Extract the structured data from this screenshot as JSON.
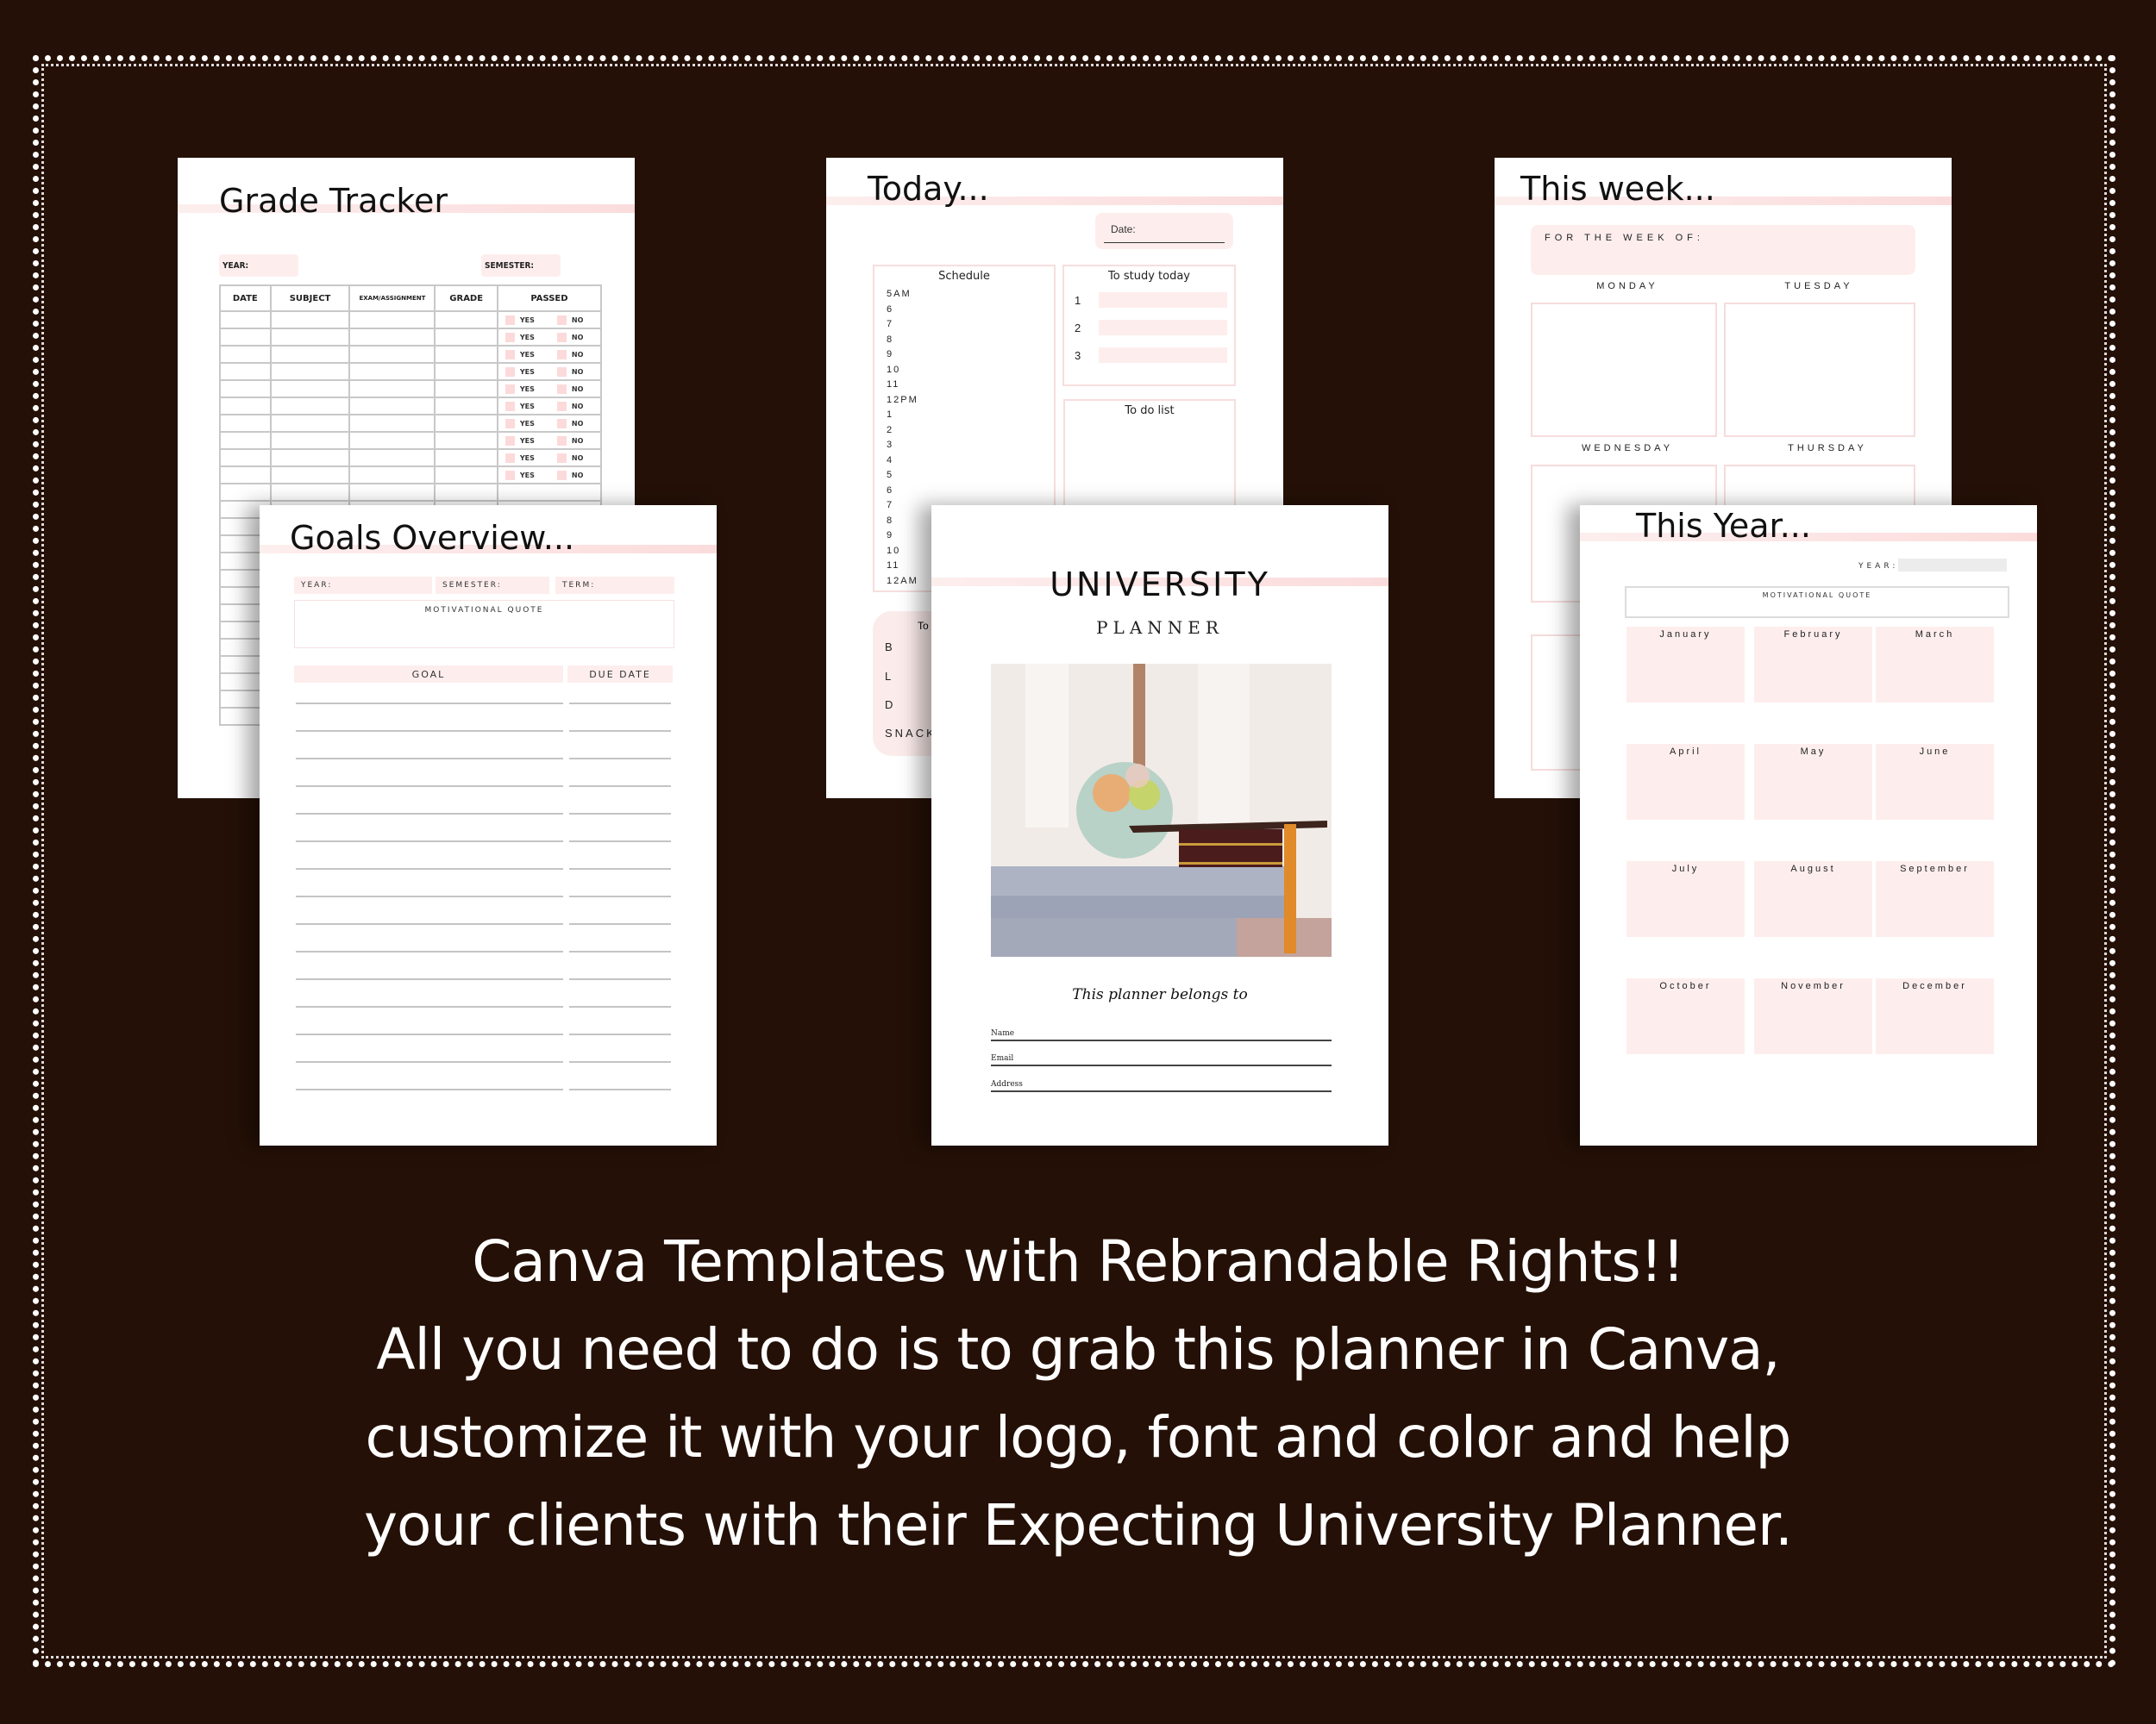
{
  "colors": {
    "background": "#241006",
    "accent_pink": "#fdeeed",
    "stripe_pink": "#fbdcdc",
    "border": "#ffffff"
  },
  "grade_tracker": {
    "title": "Grade Tracker",
    "year_label": "YEAR:",
    "semester_label": "SEMESTER:",
    "columns": [
      "DATE",
      "SUBJECT",
      "EXAM/ASSIGNMENT",
      "GRADE",
      "PASSED"
    ],
    "yes_label": "YES",
    "no_label": "NO",
    "row_count": 24
  },
  "goals_overview": {
    "title": "Goals Overview...",
    "year_label": "YEAR:",
    "semester_label": "SEMESTER:",
    "term_label": "TERM:",
    "quote_label": "MOTIVATIONAL QUOTE",
    "goal_header": "GOAL",
    "due_header": "DUE DATE",
    "line_count": 15
  },
  "today": {
    "title": "Today...",
    "date_label": "Date:",
    "schedule_title": "Schedule",
    "hours": [
      "5AM",
      "6",
      "7",
      "8",
      "9",
      "10",
      "11",
      "12PM",
      "1",
      "2",
      "3",
      "4",
      "5",
      "6",
      "7",
      "8",
      "9",
      "10",
      "11",
      "12AM"
    ],
    "study_title": "To study today",
    "study_items": [
      "1",
      "2",
      "3"
    ],
    "todo_title": "To do list",
    "meals_title": "To",
    "meals": [
      "B",
      "L",
      "D",
      "SNACK"
    ]
  },
  "cover": {
    "title": "UNIVERSITY",
    "subtitle": "PLANNER",
    "photo_description": "graduation cap on books with globe",
    "belongs_label": "This planner belongs to",
    "fields": [
      "Name",
      "Email",
      "Address"
    ]
  },
  "this_week": {
    "title": "This week...",
    "week_of_label": "FOR THE WEEK OF:",
    "days": [
      "MONDAY",
      "TUESDAY",
      "WEDNESDAY",
      "THURSDAY"
    ]
  },
  "this_year": {
    "title": "This Year...",
    "year_label": "YEAR:",
    "quote_label": "MOTIVATIONAL QUOTE",
    "months": [
      "January",
      "February",
      "March",
      "April",
      "May",
      "June",
      "July",
      "August",
      "September",
      "October",
      "November",
      "December"
    ]
  },
  "caption": {
    "lines": [
      "Canva Templates with Rebrandable Rights!!",
      "All you need to do is to grab this planner in Canva,",
      "customize it with your logo, font and color and help",
      "your clients with their Expecting University Planner."
    ]
  }
}
